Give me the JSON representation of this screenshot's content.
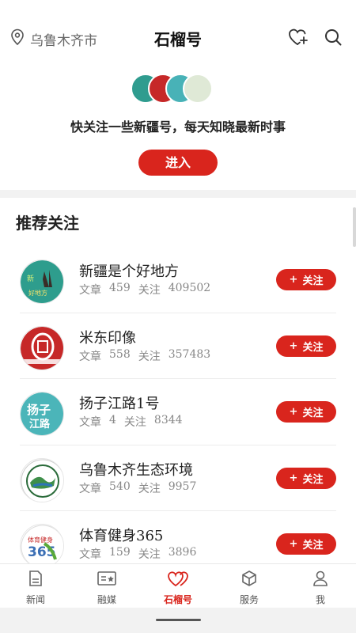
{
  "header": {
    "location": "乌鲁木齐市",
    "title": "石榴号",
    "icons": [
      "location-pin-icon",
      "heart-plus-icon",
      "search-icon"
    ]
  },
  "promo": {
    "text": "快关注一些新疆号，每天知晓最新时事",
    "button_label": "进入"
  },
  "recommend": {
    "title": "推荐关注",
    "article_label": "文章",
    "follow_label": "关注",
    "follow_button_label": "关注",
    "items": [
      {
        "name": "新疆是个好地方",
        "articles": "459",
        "followers": "409502"
      },
      {
        "name": "米东印像",
        "articles": "558",
        "followers": "357483"
      },
      {
        "name": "扬子江路1号",
        "articles": "4",
        "followers": "8344"
      },
      {
        "name": "乌鲁木齐生态环境",
        "articles": "540",
        "followers": "9957"
      },
      {
        "name": "体育健身365",
        "articles": "159",
        "followers": "3896"
      }
    ]
  },
  "bottom_nav": {
    "items": [
      {
        "label": "新闻",
        "icon": "news-doc-icon"
      },
      {
        "label": "融媒",
        "icon": "media-card-icon"
      },
      {
        "label": "石榴号",
        "icon": "double-heart-icon"
      },
      {
        "label": "服务",
        "icon": "cube-icon"
      },
      {
        "label": "我",
        "icon": "person-icon"
      }
    ],
    "active_index": 2
  },
  "colors": {
    "accent": "#d9251d",
    "text": "#222222",
    "muted": "#888888"
  }
}
